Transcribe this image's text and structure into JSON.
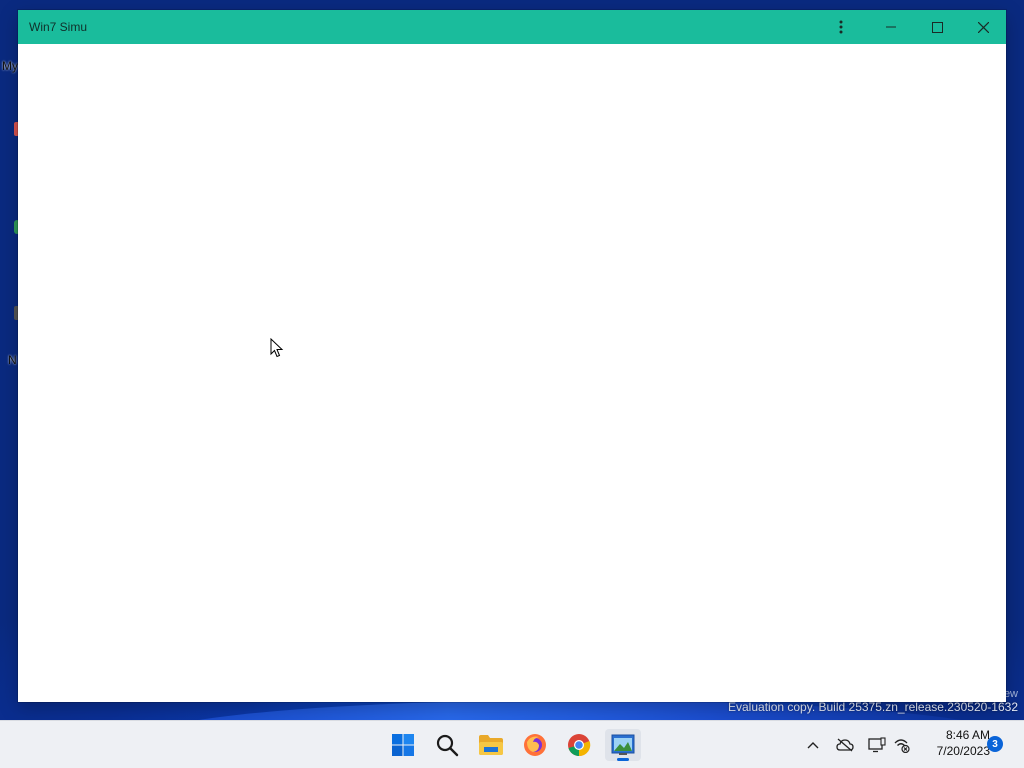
{
  "desktop": {
    "labels": [
      "My",
      "N"
    ],
    "watermark_line1": "ew",
    "watermark_line2": "Evaluation copy. Build 25375.zn_release.230520-1632"
  },
  "window": {
    "title": "Win7 Simu",
    "titlebar_color": "#1abc9c",
    "buttons": {
      "menu": "more-vert-icon",
      "minimize": "minimize-icon",
      "maximize": "maximize-icon",
      "close": "close-icon"
    }
  },
  "taskbar": {
    "apps": [
      {
        "name": "start-button",
        "icon": "windows-logo-icon"
      },
      {
        "name": "search-button",
        "icon": "search-icon"
      },
      {
        "name": "file-explorer",
        "icon": "folder-icon"
      },
      {
        "name": "firefox",
        "icon": "firefox-icon"
      },
      {
        "name": "chrome",
        "icon": "chrome-icon"
      },
      {
        "name": "win7-simu",
        "icon": "app-window-icon",
        "active": true
      }
    ],
    "tray": [
      "chevron-up-icon",
      "onedrive-off-icon",
      "display-icon",
      "network-off-icon"
    ],
    "time": "8:46 AM",
    "date": "7/20/2023",
    "notifications": "3",
    "accent_color": "#0a64d8"
  }
}
